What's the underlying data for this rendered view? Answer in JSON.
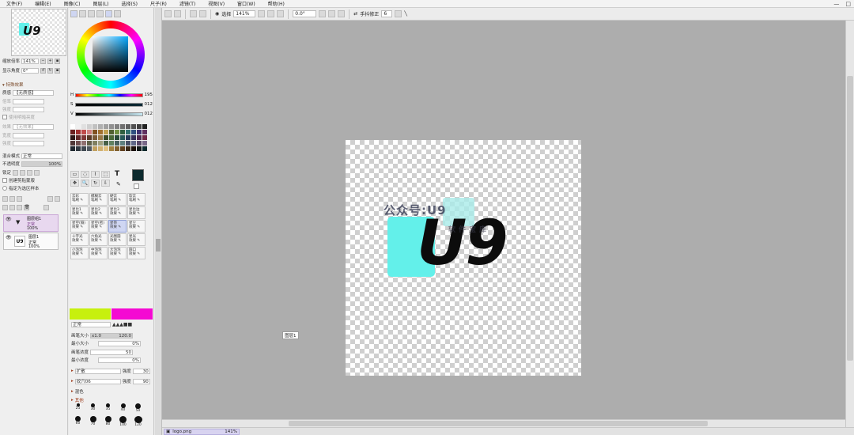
{
  "menu": [
    "文件(F)",
    "编辑(E)",
    "图像(C)",
    "图层(L)",
    "选择(S)",
    "尺子(R)",
    "滤镜(T)",
    "视图(V)",
    "窗口(W)",
    "帮助(H)"
  ],
  "window_controls": [
    "—",
    "□"
  ],
  "navigator": {
    "logo": "U9",
    "zoom_label": "缩放倍率",
    "zoom_value": "141%",
    "rotation_label": "显示角度",
    "rotation_value": "0°"
  },
  "effects": {
    "header": "特殊效果",
    "texture_label": "质感",
    "texture_value": "【无质感】",
    "scale_label": "倍率",
    "intensity_label": "强度",
    "brightness_label": "亮度",
    "use_brightness_label": "使用明暗亮度",
    "effect_label": "效果",
    "effect_value": "【无效果】",
    "width_label": "宽度",
    "strength_label": "强度"
  },
  "blend": {
    "mode_label": "混合模式",
    "mode_value": "正常",
    "opacity_label": "不透明度",
    "opacity_value": "100%",
    "lock_label": "锁定",
    "clip_label": "创建剪贴蒙版",
    "selection_source_label": "指定为选区样本"
  },
  "layers": [
    {
      "name": "图层组1",
      "mode": "正常",
      "opacity": "100%"
    },
    {
      "name": "图层1",
      "mode": "正常",
      "opacity": "100%",
      "thumb": "U9"
    }
  ],
  "color": {
    "H_label": "H",
    "H": "195",
    "S_label": "S",
    "S": "012",
    "V_label": "V",
    "V": "012",
    "foreground": "#0c2a2e",
    "accent_yellow": "#c7f00e",
    "accent_magenta": "#f40ad2"
  },
  "tools": [
    "▭",
    "◌",
    "⌇",
    "⬚",
    "T",
    "✥",
    "🔍",
    "↻",
    "⇩",
    "✎"
  ],
  "brushes": [
    {
      "name": "云彩",
      "sub": "笔刷"
    },
    {
      "name": "模糊云",
      "sub": "笔刷"
    },
    {
      "name": "硬云",
      "sub": "笔刷"
    },
    {
      "name": "软云",
      "sub": "笔刷"
    },
    {
      "name": "星比1",
      "sub": "效果"
    },
    {
      "name": "星比2",
      "sub": "效果"
    },
    {
      "name": "星比3",
      "sub": "效果"
    },
    {
      "name": "星比边",
      "sub": "效果"
    },
    {
      "name": "星空(隔)",
      "sub": "效果"
    },
    {
      "name": "星空(密)",
      "sub": "效果"
    },
    {
      "name": "星带",
      "sub": "效果",
      "selected": true
    },
    {
      "name": "星尘",
      "sub": "效果"
    },
    {
      "name": "十字光",
      "sub": "效果"
    },
    {
      "name": "六角光",
      "sub": "效果"
    },
    {
      "name": "光圈圆",
      "sub": "效果"
    },
    {
      "name": "星光",
      "sub": "效果"
    },
    {
      "name": "小泡泡",
      "sub": "效果"
    },
    {
      "name": "中泡泡",
      "sub": "效果"
    },
    {
      "name": "大泡泡",
      "sub": "效果"
    },
    {
      "name": "圆口",
      "sub": "效果"
    }
  ],
  "brush_settings": {
    "mode": "正常",
    "size_label": "画笔大小",
    "size_mult": "x1.0",
    "size_value": "120.0",
    "min_size_label": "最小大小",
    "min_size_value": "0%",
    "density_label": "画笔浓度",
    "density_value": "50",
    "min_density_label": "最小浓度",
    "min_density_value": "0%",
    "spread_label": "扩散",
    "spread_strength_label": "强度",
    "spread_strength": "30",
    "texture_label": "纹穴06",
    "texture_strength_label": "强度",
    "texture_strength": "90",
    "mix_label": "混色",
    "other_label": "其他",
    "sizes": [
      "25",
      "30",
      "35",
      "40",
      "50",
      "60",
      "70",
      "80",
      "100",
      "120"
    ]
  },
  "toolbar": {
    "select_label": "选择",
    "zoom": "141%",
    "angle": "0.0°",
    "stabilizer_label": "手抖修正",
    "stabilizer_value": "6"
  },
  "canvas": {
    "watermark": "公众号:U9",
    "subtitle": "软件宝库",
    "logo_text": "U9",
    "layer_tag": "图层1"
  },
  "status": {
    "file": "logo.png",
    "zoom": "141%"
  }
}
